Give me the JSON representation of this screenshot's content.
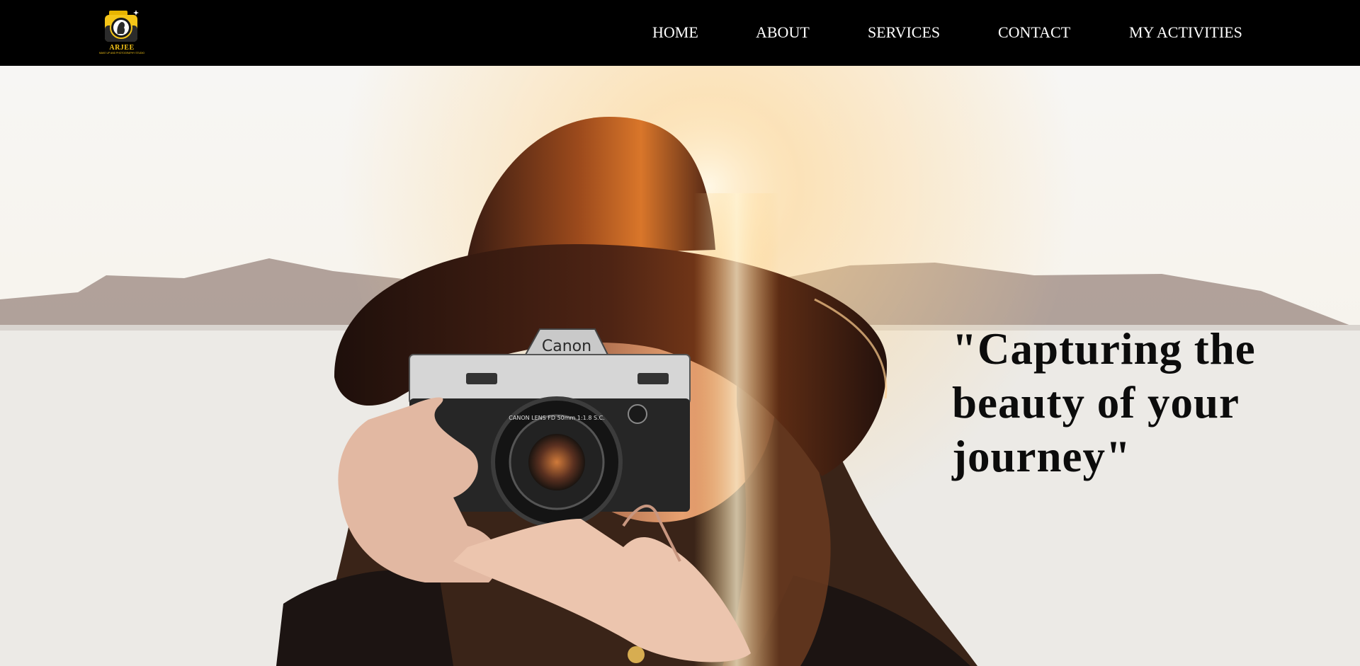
{
  "brand": {
    "name": "ARJEE",
    "tagline": "MAKE UP AND PHOTOGRAPHY STUDIO",
    "color": "#f5c518"
  },
  "nav": {
    "items": [
      {
        "label": "HOME"
      },
      {
        "label": "ABOUT"
      },
      {
        "label": "SERVICES"
      },
      {
        "label": "CONTACT"
      },
      {
        "label": "MY ACTIVITIES"
      }
    ]
  },
  "hero": {
    "quote": "\"Capturing the beauty of your journey\"",
    "camera_brand": "Canon",
    "lens_text": "CANON LENS FD 50mm 1:1.8 S.C."
  },
  "colors": {
    "navbar_bg": "#000000",
    "nav_text": "#ffffff",
    "quote_text": "#0c0c0c"
  }
}
